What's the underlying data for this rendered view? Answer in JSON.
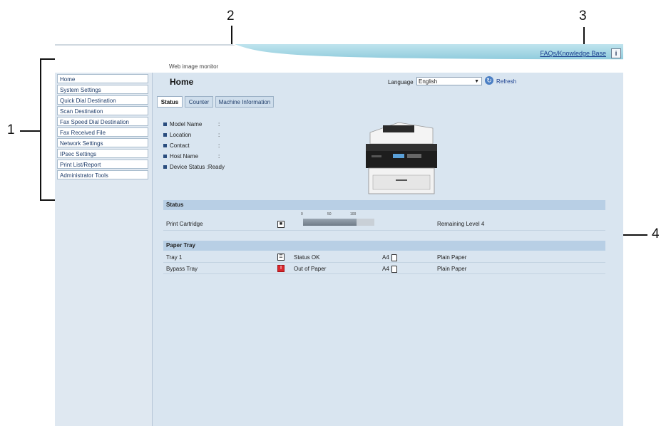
{
  "callouts": [
    "1",
    "2",
    "3",
    "4"
  ],
  "header": {
    "subtitle": "Web image monitor",
    "faq_link": "FAQs/Knowledge Base",
    "info_icon": "i"
  },
  "sidebar": {
    "items": [
      {
        "label": "Home"
      },
      {
        "label": "System Settings"
      },
      {
        "label": "Quick Dial Destination"
      },
      {
        "label": "Scan Destination"
      },
      {
        "label": "Fax Speed Dial Destination"
      },
      {
        "label": "Fax Received File"
      },
      {
        "label": "Network Settings"
      },
      {
        "label": "IPsec Settings"
      },
      {
        "label": "Print List/Report"
      },
      {
        "label": "Administrator Tools"
      }
    ]
  },
  "main": {
    "title": "Home",
    "language_label": "Language",
    "language_value": "English",
    "refresh_label": "Refresh",
    "tabs": [
      {
        "label": "Status"
      },
      {
        "label": "Counter"
      },
      {
        "label": "Machine Information"
      }
    ],
    "device_info": [
      {
        "label": "Model Name",
        "value": ":"
      },
      {
        "label": "Location",
        "value": ":"
      },
      {
        "label": "Contact",
        "value": ":"
      },
      {
        "label": "Host Name",
        "value": ":"
      },
      {
        "label": "Device Status",
        "value": ":Ready"
      }
    ],
    "status_section": {
      "heading": "Status",
      "scale_ticks": [
        "0",
        "50",
        "100"
      ],
      "cartridge": {
        "label": "Print Cartridge",
        "level_percent": 75,
        "remaining": "Remaining Level 4"
      }
    },
    "paper_section": {
      "heading": "Paper Tray",
      "trays": [
        {
          "name": "Tray 1",
          "status": "Status OK",
          "size": "A4",
          "type": "Plain Paper",
          "icon": "tray-ok-icon"
        },
        {
          "name": "Bypass Tray",
          "status": "Out of Paper",
          "size": "A4",
          "type": "Plain Paper",
          "icon": "tray-empty-icon"
        }
      ]
    }
  },
  "colors": {
    "main_bg": "#d9e5f0",
    "section_bar": "#b8cfe5",
    "error_red": "#d9262c"
  }
}
